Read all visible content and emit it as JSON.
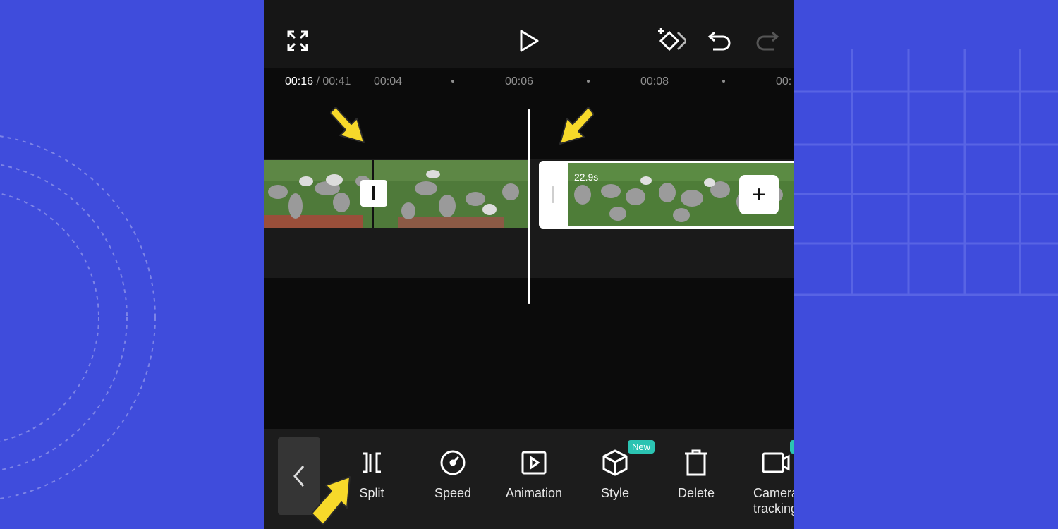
{
  "timeline": {
    "current_time": "00:16",
    "total_time": " / 00:41",
    "ticks": [
      "00:04",
      "00:06",
      "00:08",
      "00:"
    ]
  },
  "clips": [
    {
      "position": "before-playhead"
    },
    {
      "duration": "22.9s"
    }
  ],
  "toolbar": {
    "tools": [
      {
        "label": "Split",
        "icon": "split-icon"
      },
      {
        "label": "Speed",
        "icon": "speed-icon"
      },
      {
        "label": "Animation",
        "icon": "animation-icon"
      },
      {
        "label": "Style",
        "icon": "style-icon",
        "badge": "New"
      },
      {
        "label": "Delete",
        "icon": "delete-icon"
      },
      {
        "label": "Camera\ntracking",
        "icon": "camera-tracking-icon"
      }
    ]
  },
  "top_icons": [
    "fullscreen-icon",
    "play-icon",
    "keyframe-icon",
    "undo-icon",
    "redo-icon"
  ],
  "colors": {
    "background": "#3f4cdc",
    "phone_bg": "#0b0b0b",
    "toolbar_bg": "#1c1c1c",
    "badge": "#2bc3b2",
    "arrow": "#f7d92a"
  }
}
